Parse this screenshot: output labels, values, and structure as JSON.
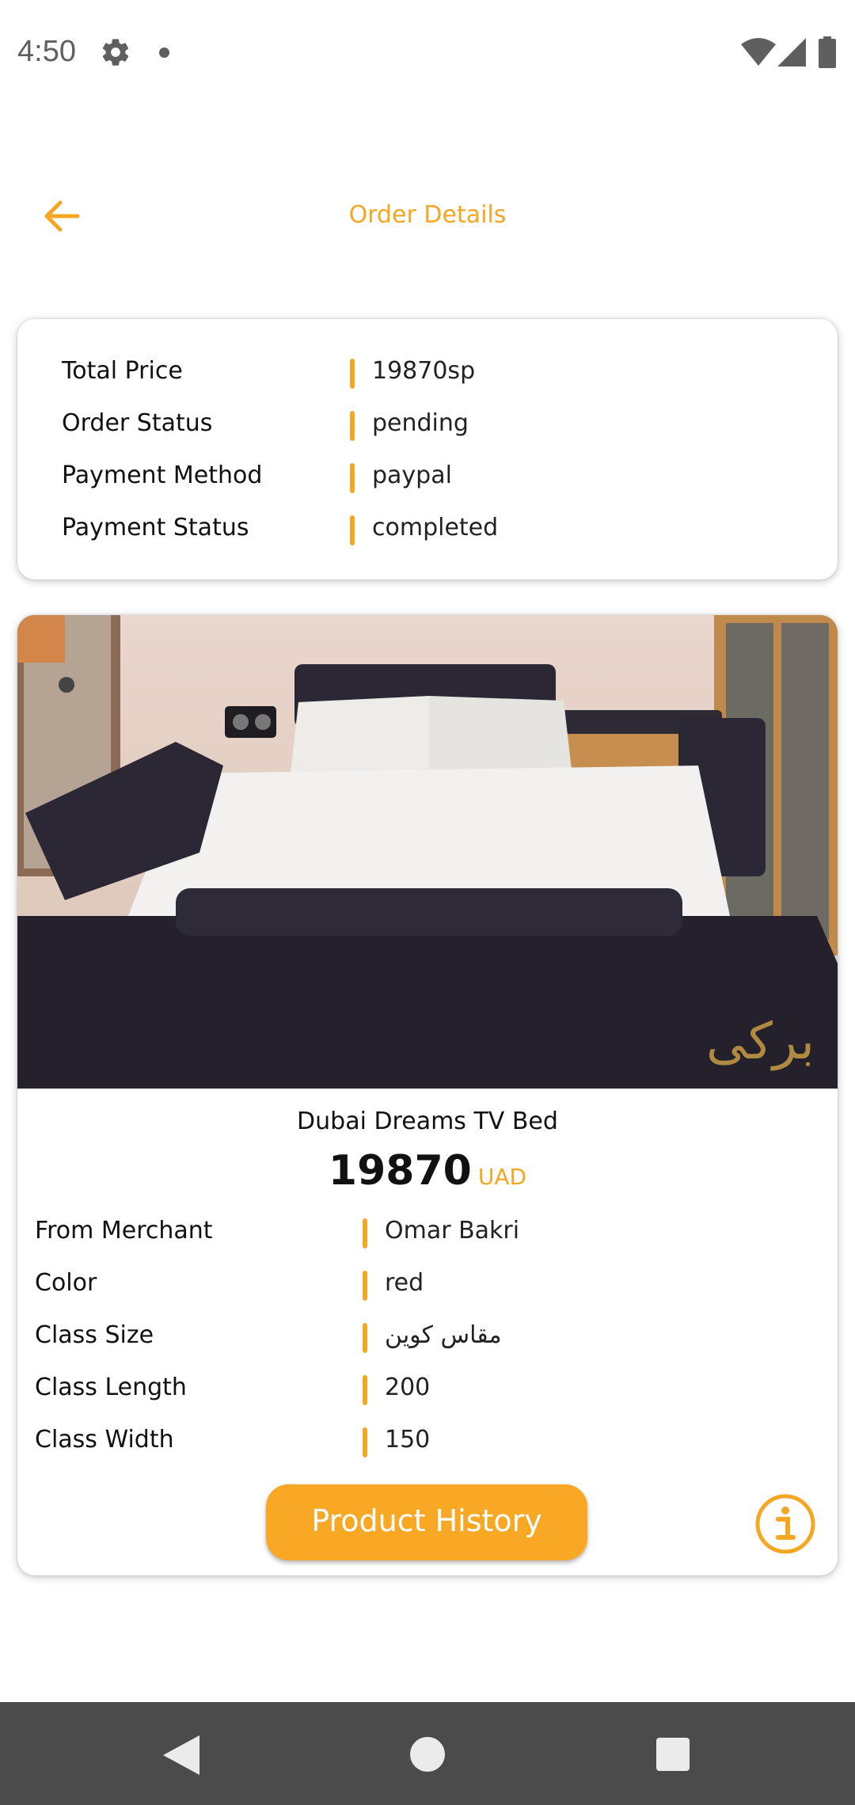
{
  "status_bar": {
    "time": "4:50",
    "icons": [
      "gear-icon",
      "notification-dot-icon",
      "wifi-icon",
      "signal-icon",
      "battery-icon"
    ]
  },
  "header": {
    "title": "Order Details",
    "back_icon": "arrow-left-icon"
  },
  "order_summary": {
    "rows": [
      {
        "label": "Total Price",
        "value": "19870sp"
      },
      {
        "label": "Order Status",
        "value": "pending"
      },
      {
        "label": "Payment Method",
        "value": "paypal"
      },
      {
        "label": "Payment Status",
        "value": "completed"
      }
    ]
  },
  "product": {
    "name": "Dubai Dreams TV Bed",
    "price": "19870",
    "currency": "UAD",
    "details": [
      {
        "label": "From Merchant",
        "value": "Omar Bakri"
      },
      {
        "label": "Color",
        "value": "red"
      },
      {
        "label": "Class Size",
        "value": "مقاس كوين"
      },
      {
        "label": "Class Length",
        "value": "200"
      },
      {
        "label": "Class Width",
        "value": "150"
      }
    ],
    "history_button": "Product History",
    "info_icon": "info-icon"
  },
  "nav_bar": {
    "icons": [
      "nav-back-icon",
      "nav-home-icon",
      "nav-recents-icon"
    ]
  },
  "colors": {
    "accent": "#f5a623",
    "button": "#f9a825",
    "nav_bar": "#4b4b4b"
  }
}
